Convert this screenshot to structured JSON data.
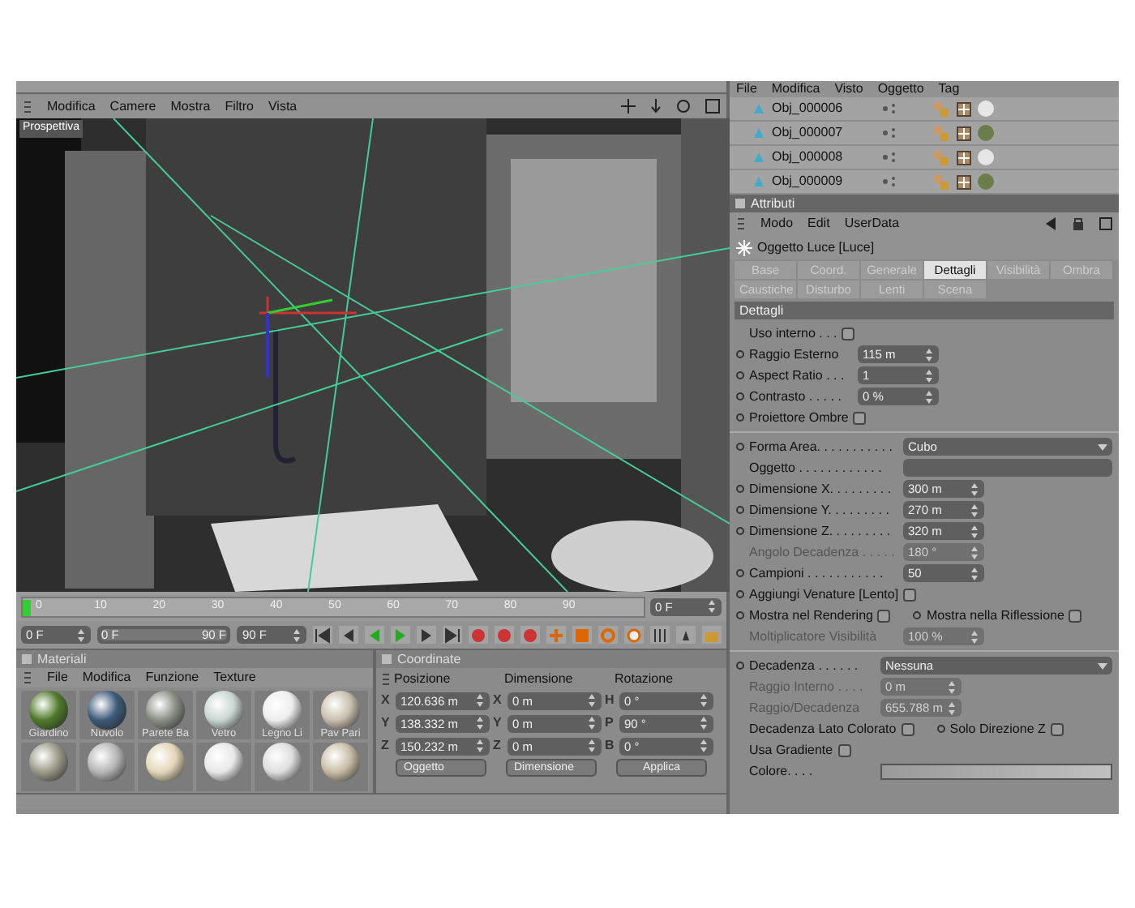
{
  "viewport": {
    "menu": [
      "Modifica",
      "Camere",
      "Mostra",
      "Filtro",
      "Vista"
    ],
    "label": "Prospettiva"
  },
  "timeline": {
    "ticks": [
      "0",
      "10",
      "20",
      "30",
      "40",
      "50",
      "60",
      "70",
      "80",
      "90"
    ],
    "level": 0,
    "frame_field": "0 F"
  },
  "transport": {
    "start_field": "0 F",
    "range_start": "0 F",
    "range_end": "90 F",
    "level": 1,
    "end_field": "90 F"
  },
  "materials": {
    "title": "Materiali",
    "menu": [
      "File",
      "Modifica",
      "Funzione",
      "Texture"
    ],
    "items": [
      {
        "name": "Giardino",
        "color": "#4f7a2a"
      },
      {
        "name": "Nuvolo",
        "color": "#3d5a78"
      },
      {
        "name": "Parete Ba",
        "color": "#8c8f86"
      },
      {
        "name": "Vetro",
        "color": "#c9d6d2"
      },
      {
        "name": "Legno Li",
        "color": "#eeeeee"
      },
      {
        "name": "Pav Pari",
        "color": "#c8bfae"
      },
      {
        "color": "#9a9a8a"
      },
      {
        "color": "#b5b5b5"
      },
      {
        "color": "#e3d7b8"
      },
      {
        "color": "#e8e8e8"
      },
      {
        "color": "#dedede"
      },
      {
        "color": "#c9bda6"
      }
    ]
  },
  "coordinates": {
    "title": "Coordinate",
    "columns": [
      "Posizione",
      "Dimensione",
      "Rotazione"
    ],
    "rows": [
      {
        "pos_axis": "X",
        "position": "120.636 m",
        "dim_axis": "X",
        "dimension": "0 m",
        "rot_axis": "H",
        "rotation": "0 °"
      },
      {
        "pos_axis": "Y",
        "position": "138.332 m",
        "dim_axis": "Y",
        "dimension": "0 m",
        "rot_axis": "P",
        "rotation": "90 °"
      },
      {
        "pos_axis": "Z",
        "position": "150.232 m",
        "dim_axis": "Z",
        "dimension": "0 m",
        "rot_axis": "B",
        "rotation": "0 °"
      }
    ],
    "dropdowns": [
      "Oggetto",
      "Dimensione"
    ],
    "apply_button": "Applica"
  },
  "object_manager": {
    "menu": [
      "File",
      "Modifica",
      "Visto",
      "Oggetto",
      "Tag"
    ],
    "objects": [
      {
        "name": "Obj_000006",
        "color": "#e6e6e6"
      },
      {
        "name": "Obj_000007",
        "color": "#6b7d4a"
      },
      {
        "name": "Obj_000008",
        "color": "#e6e6e6"
      },
      {
        "name": "Obj_000009",
        "color": "#6b7d4a"
      }
    ]
  },
  "attributes": {
    "title": "Attributi",
    "menu": [
      "Modo",
      "Edit",
      "UserData"
    ],
    "object": "Oggetto Luce [Luce]",
    "tab_rows": [
      [
        {
          "label": "Base",
          "selected": false
        },
        {
          "label": "Coord.",
          "selected": false
        },
        {
          "label": "Generale",
          "selected": false
        },
        {
          "label": "Dettagli",
          "selected": true
        },
        {
          "label": "Visibilità",
          "selected": false
        },
        {
          "label": "Ombra",
          "selected": false
        }
      ],
      [
        {
          "label": "Caustiche",
          "selected": false
        },
        {
          "label": "Disturbo",
          "selected": false
        },
        {
          "label": "Lenti",
          "selected": false
        },
        {
          "label": "Scena",
          "selected": false
        }
      ]
    ],
    "section": "Dettagli",
    "groups": [
      {
        "fields": [
          {
            "kind": "check",
            "label": "Uso interno . . .",
            "anim": false,
            "checked": false,
            "disabled": false
          },
          {
            "kind": "number",
            "label": "Raggio Esterno",
            "anim": true,
            "value": "115 m",
            "disabled": false
          },
          {
            "kind": "number",
            "label": "Aspect Ratio . . .",
            "anim": true,
            "value": "1",
            "disabled": false
          },
          {
            "kind": "number",
            "label": "Contrasto . . . . .",
            "anim": true,
            "value": "0 %",
            "disabled": false
          },
          {
            "kind": "check",
            "label": "Proiettore Ombre",
            "anim": true,
            "checked": false,
            "disabled": false
          }
        ]
      },
      {
        "fields": [
          {
            "kind": "dropdown",
            "label": "Forma Area. . . . . . . . . . .",
            "anim": true,
            "value": "Cubo",
            "disabled": false
          },
          {
            "kind": "object",
            "label": "Oggetto . . . . . . . . . . . .",
            "anim": false,
            "disabled": false
          },
          {
            "kind": "number",
            "label": "Dimensione X. . . . . . . . .",
            "anim": true,
            "value": "300 m",
            "disabled": false
          },
          {
            "kind": "number",
            "label": "Dimensione Y. . . . . . . . .",
            "anim": true,
            "value": "270 m",
            "disabled": false
          },
          {
            "kind": "number",
            "label": "Dimensione Z. . . . . . . . .",
            "anim": true,
            "value": "320 m",
            "disabled": false
          },
          {
            "kind": "number",
            "label": "Angolo Decadenza . . . . .",
            "anim": false,
            "value": "180 °",
            "disabled": true
          },
          {
            "kind": "number",
            "label": "Campioni . . . . . . . . . . .",
            "anim": true,
            "value": "50",
            "disabled": false
          },
          {
            "kind": "check",
            "label": "Aggiungi Venature [Lento]",
            "anim": true,
            "checked": false,
            "disabled": false
          },
          {
            "kind": "check_pair",
            "items": [
              {
                "label": "Mostra nel Rendering",
                "anim": true,
                "checked": false
              },
              {
                "label": "Mostra nella Riflessione",
                "anim": true,
                "checked": false
              }
            ],
            "disabled": false
          },
          {
            "kind": "number",
            "label": "Moltiplicatore Visibilità",
            "anim": false,
            "value": "100 %",
            "disabled": true
          }
        ]
      },
      {
        "fields": [
          {
            "kind": "dropdown",
            "label": "Decadenza . . . . . .",
            "anim": true,
            "value": "Nessuna",
            "disabled": false
          },
          {
            "kind": "number",
            "label": "Raggio Interno . . . .",
            "anim": false,
            "value": "0 m",
            "disabled": true
          },
          {
            "kind": "number",
            "label": "Raggio/Decadenza",
            "anim": false,
            "value": "655.788 m",
            "disabled": true
          },
          {
            "kind": "check_pair",
            "items": [
              {
                "label": "Decadenza Lato Colorato",
                "anim": false,
                "checked": false
              },
              {
                "label": "Solo Direzione Z",
                "anim": true,
                "checked": false
              }
            ],
            "disabled": false
          },
          {
            "kind": "check",
            "label": "Usa Gradiente",
            "anim": false,
            "checked": false,
            "disabled": false
          },
          {
            "kind": "gradient",
            "label": "Colore. . . .",
            "anim": false,
            "disabled": false
          }
        ]
      }
    ]
  }
}
